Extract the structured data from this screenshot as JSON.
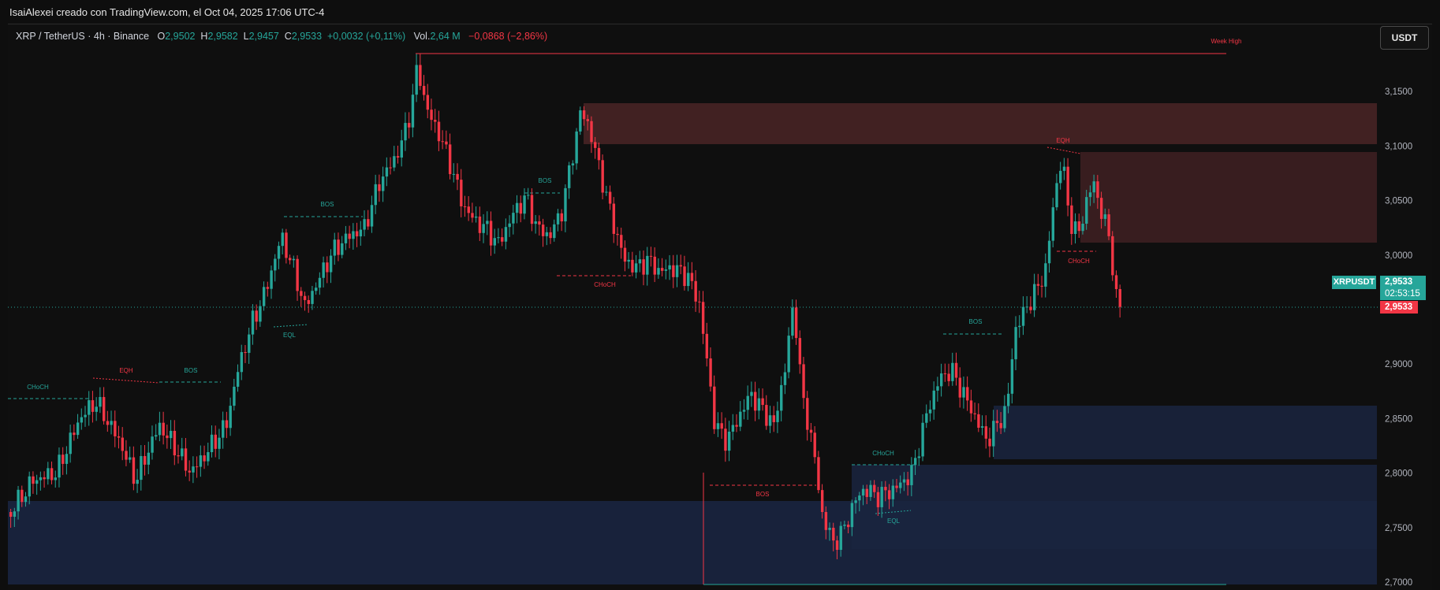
{
  "attribution": "IsaiAlexei creado con TradingView.com, el Oct 04, 2025 17:06 UTC-4",
  "legend": {
    "symbol": "XRP / TetherUS · 4h · Binance",
    "o_label": "O",
    "o": "2,9502",
    "h_label": "H",
    "h": "2,9582",
    "l_label": "L",
    "l": "2,9457",
    "c_label": "C",
    "c": "2,9533",
    "change": "+0,0032 (+0,11%)",
    "vol_label": "Vol.",
    "vol": "2,64 M",
    "vol_change": "−0,0868 (−2,86%)"
  },
  "currency": "USDT",
  "price_axis": {
    "ticks": [
      "3,1500",
      "3,1000",
      "3,0500",
      "3,0000",
      "2,9000",
      "2,8500",
      "2,8000",
      "2,7500",
      "2,7000"
    ],
    "ymin": 2.7,
    "ymax": 3.15
  },
  "price_tag": {
    "symbol": "XRPUSDT",
    "price": "2,9533",
    "countdown": "02:53:15",
    "last": "2,9533"
  },
  "annotations": {
    "week_high": "Week High",
    "choch": "CHoCH",
    "eqh": "EQH",
    "bos": "BOS",
    "eql": "EQL"
  },
  "colors": {
    "bull": "#26a69a",
    "bear": "#f23645",
    "supply_zone": "#4a2426",
    "demand_zone": "#1a2540",
    "background": "#0e0e0e"
  }
}
